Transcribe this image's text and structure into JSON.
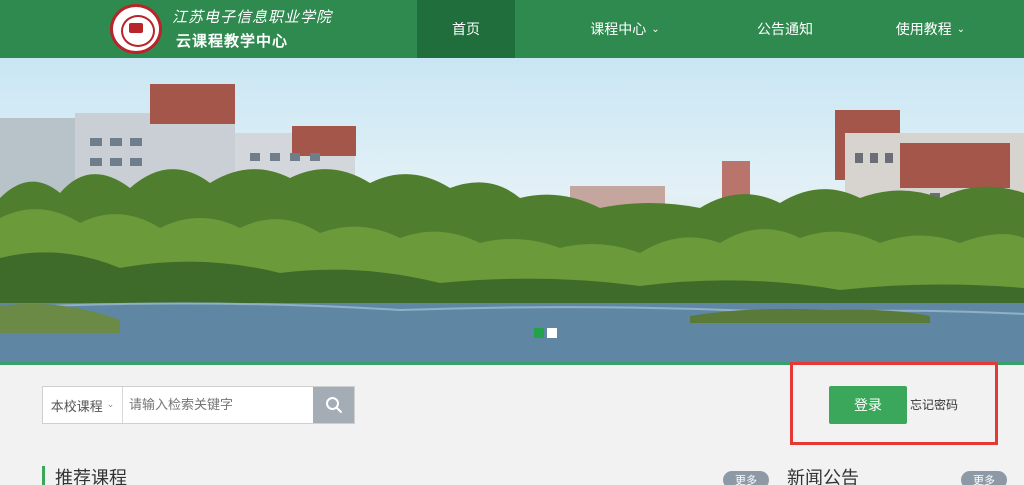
{
  "header": {
    "logo_school_name": "江苏电子信息职业学院",
    "logo_subtitle": "云课程教学中心",
    "nav": [
      {
        "label": "首页",
        "active": true,
        "dropdown": false
      },
      {
        "label": "课程中心",
        "active": false,
        "dropdown": true
      },
      {
        "label": "公告通知",
        "active": false,
        "dropdown": false
      },
      {
        "label": "使用教程",
        "active": false,
        "dropdown": true
      }
    ],
    "chevron": "⌄"
  },
  "banner": {
    "slides": 2,
    "active_slide": 1
  },
  "search": {
    "scope_label": "本校课程",
    "scope_chevron": "⌄",
    "placeholder": "请输入检索关键字"
  },
  "login": {
    "button_label": "登录",
    "forgot_label": "忘记密码"
  },
  "sections": {
    "recommended_title": "推荐课程",
    "news_title": "新闻公告",
    "more_label": "更多"
  },
  "colors": {
    "header_green": "#2f8a4f",
    "nav_active": "#1f6e3c",
    "login_green": "#3aa75a",
    "highlight_red": "#e53935"
  }
}
